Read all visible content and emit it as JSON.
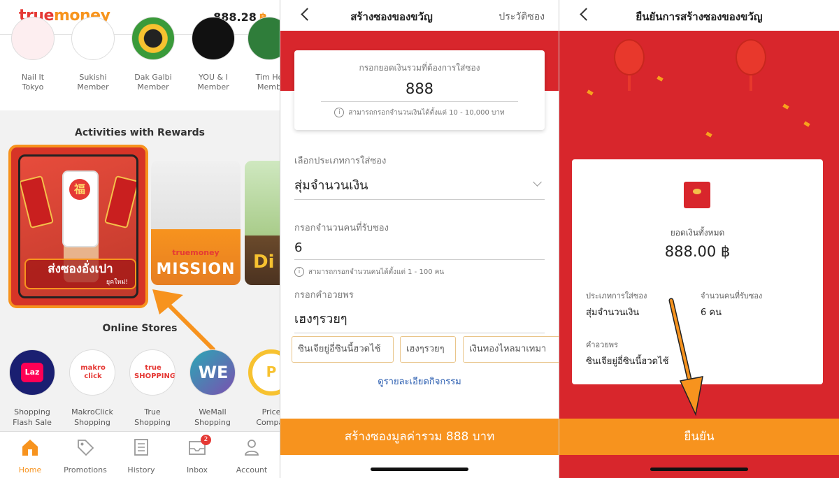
{
  "home": {
    "logo_part1": "true",
    "logo_part2": "money",
    "balance": "888.28",
    "currency": "฿",
    "merchants": [
      {
        "name": "Nail It\nTokyo",
        "icon": "nail-it-logo"
      },
      {
        "name": "Sukishi\nMember",
        "icon": "sukishi-logo"
      },
      {
        "name": "Dak Galbi\nMember",
        "icon": "dak-galbi-logo"
      },
      {
        "name": "YOU & I\nMember",
        "icon": "you-and-i-logo"
      },
      {
        "name": "Tim Ho\nMemb",
        "icon": "tim-ho-logo"
      }
    ],
    "activities_title": "Activities with Rewards",
    "activity_main": {
      "label": "ส่งซองอั่งเปา",
      "sub": "ยุคใหม่!",
      "glyph": "福"
    },
    "activity_mission": {
      "brand": "truemoney",
      "label": "MISSION"
    },
    "activity_third": {
      "label": "Di"
    },
    "online_stores_title": "Online Stores",
    "stores": [
      {
        "name": "Shopping\nFlash Sale",
        "logo_text": "Laz",
        "color": "#1a1f71"
      },
      {
        "name": "MakroClick\nShopping",
        "logo_text": "makro click",
        "color": "#e53935"
      },
      {
        "name": "True\nShopping",
        "logo_text": "true SHOPPING",
        "color": "#e53935"
      },
      {
        "name": "WeMall\nShopping",
        "logo_text": "WE",
        "color": "#2aa8b5"
      },
      {
        "name": "Price\nCompar",
        "logo_text": "P",
        "color": "#f7c230"
      }
    ],
    "nav": [
      {
        "label": "Home",
        "icon": "home-icon",
        "active": true
      },
      {
        "label": "Promotions",
        "icon": "tag-icon"
      },
      {
        "label": "History",
        "icon": "history-icon"
      },
      {
        "label": "Inbox",
        "icon": "inbox-icon",
        "badge": "2"
      },
      {
        "label": "Account",
        "icon": "account-icon"
      }
    ]
  },
  "create": {
    "title": "สร้างซองของขวัญ",
    "history_link": "ประวัติซอง",
    "amount_placeholder": "กรอกยอดเงินรวมที่ต้องการใส่ซอง",
    "amount_value": "888",
    "amount_hint": "สามารถกรอกจำนวนเงินได้ตั้งแต่ 10 - 10,000 บาท",
    "type_label": "เลือกประเภทการใส่ซอง",
    "type_value": "สุ่มจำนวนเงิน",
    "recipients_label": "กรอกจำนวนคนที่รับซอง",
    "recipients_value": "6",
    "recipients_hint": "สามารถกรอกจำนวนคนได้ตั้งแต่ 1 - 100 คน",
    "blessing_label": "กรอกคำอวยพร",
    "blessing_value": "เฮงๆรวยๆ",
    "blessing_chips": [
      "ซินเจียยู่อี่ซินนี้ฮวดไช้",
      "เฮงๆรวยๆ",
      "เงินทองไหลมาเทมา"
    ],
    "details_link": "ดูรายละเอียดกิจกรรม",
    "cta": "สร้างซองมูลค่ารวม 888 บาท"
  },
  "confirm": {
    "title": "ยืนยันการสร้างซองของขวัญ",
    "total_label": "ยอดเงินทั้งหมด",
    "total_value": "888.00 ฿",
    "type_label": "ประเภทการใส่ซอง",
    "type_value": "สุ่มจำนวนเงิน",
    "recipients_label": "จำนวนคนที่รับซอง",
    "recipients_value": "6 คน",
    "blessing_label": "คำอวยพร",
    "blessing_value": "ซินเจียยู่อี่ซินนี้ฮวดไช้",
    "cta": "ยืนยัน"
  },
  "colors": {
    "accent": "#f7931e",
    "red": "#d8262c",
    "link": "#2a5db0"
  }
}
